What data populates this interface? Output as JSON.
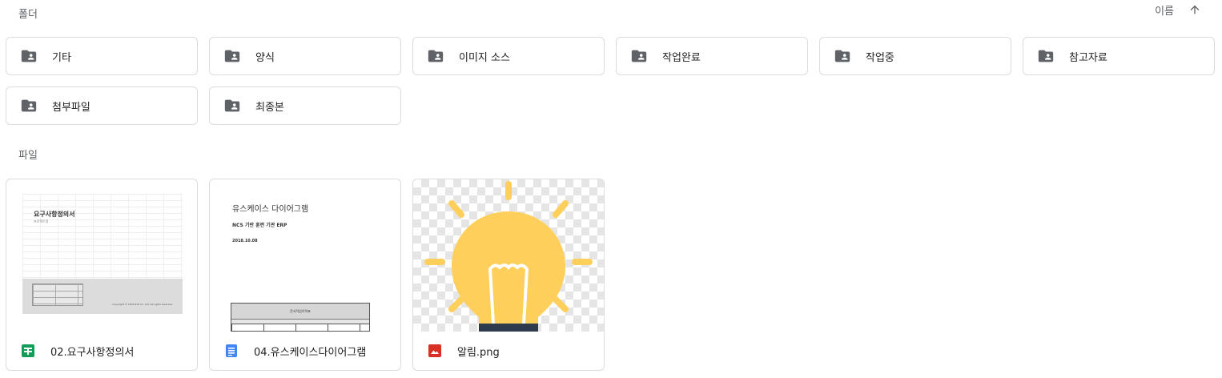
{
  "folders_section": {
    "label": "폴더",
    "sort_label": "이름",
    "sort_icon": "arrow-up-icon"
  },
  "folders": [
    {
      "name": "기타",
      "icon": "shared-folder-icon"
    },
    {
      "name": "양식",
      "icon": "shared-folder-icon"
    },
    {
      "name": "이미지 소스",
      "icon": "shared-folder-icon"
    },
    {
      "name": "작업완료",
      "icon": "shared-folder-icon"
    },
    {
      "name": "작업중",
      "icon": "shared-folder-icon"
    },
    {
      "name": "참고자료",
      "icon": "shared-folder-icon"
    },
    {
      "name": "첨부파일",
      "icon": "shared-folder-icon"
    },
    {
      "name": "최종본",
      "icon": "shared-folder-icon"
    }
  ],
  "files_section": {
    "label": "파일"
  },
  "files": [
    {
      "name": "02.요구사항정의서",
      "icon": "google-sheets-icon",
      "icon_color": "#0f9d58",
      "thumb": {
        "title": "요구사항정의서",
        "sub": "프로젝트명",
        "copyright": "Copyright © 2018 Edit Co. Ltd. All rights reserved."
      }
    },
    {
      "name": "04.유스케이스다이어그램",
      "icon": "google-docs-icon",
      "icon_color": "#4285f4",
      "thumb": {
        "title": "유스케이스 다이어그램",
        "sub": "NCS 기반 훈련 기관 ERP",
        "date": "2018.10.08",
        "table_title": "문서작업이력표"
      }
    },
    {
      "name": "알림.png",
      "icon": "image-file-icon",
      "icon_color": "#d93025",
      "thumb": {
        "bulb_color": "#fecf5b",
        "base_color": "#2e3b4e"
      }
    }
  ],
  "colors": {
    "border": "#dadce0",
    "icon_gray": "#5f6368",
    "text": "#202124"
  }
}
